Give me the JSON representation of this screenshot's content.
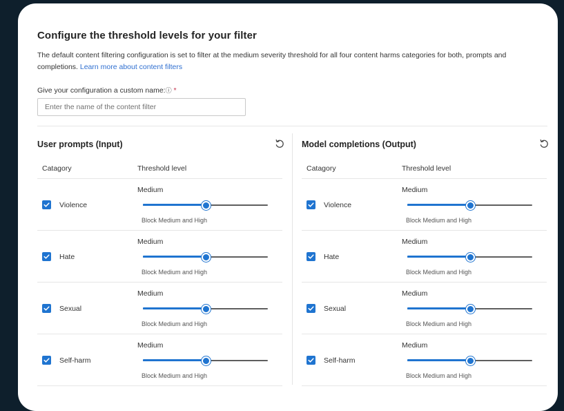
{
  "title": "Configure the threshold levels for your filter",
  "description": "The default content filtering configuration is set to filter at the medium severity threshold for all four content harms categories for both, prompts and completions.",
  "learn_more_link": "Learn more about content filters",
  "name_field": {
    "label": "Give your configuration a custom name:",
    "info_glyph": "ⓘ",
    "required_mark": "*",
    "value": "",
    "placeholder": "Enter the name of the content filter"
  },
  "accent_color": "#1f74d0",
  "icons": {
    "reset": "reset-icon",
    "checkbox": "checkmark-icon",
    "info": "info-icon"
  },
  "panels": [
    {
      "title": "User prompts (Input)",
      "col_category": "Catagory",
      "col_threshold": "Threshold level",
      "rows": [
        {
          "category": "Violence",
          "checked": true,
          "level": "Medium",
          "level_fraction": 0.5,
          "sub": "Block Medium and High"
        },
        {
          "category": "Hate",
          "checked": true,
          "level": "Medium",
          "level_fraction": 0.5,
          "sub": "Block Medium and High"
        },
        {
          "category": "Sexual",
          "checked": true,
          "level": "Medium",
          "level_fraction": 0.5,
          "sub": "Block Medium and High"
        },
        {
          "category": "Self-harm",
          "checked": true,
          "level": "Medium",
          "level_fraction": 0.5,
          "sub": "Block Medium and High"
        }
      ]
    },
    {
      "title": "Model completions (Output)",
      "col_category": "Catagory",
      "col_threshold": "Threshold level",
      "rows": [
        {
          "category": "Violence",
          "checked": true,
          "level": "Medium",
          "level_fraction": 0.5,
          "sub": "Block Medium and High"
        },
        {
          "category": "Hate",
          "checked": true,
          "level": "Medium",
          "level_fraction": 0.5,
          "sub": "Block Medium and High"
        },
        {
          "category": "Sexual",
          "checked": true,
          "level": "Medium",
          "level_fraction": 0.5,
          "sub": "Block Medium and High"
        },
        {
          "category": "Self-harm",
          "checked": true,
          "level": "Medium",
          "level_fraction": 0.5,
          "sub": "Block Medium and High"
        }
      ]
    }
  ]
}
